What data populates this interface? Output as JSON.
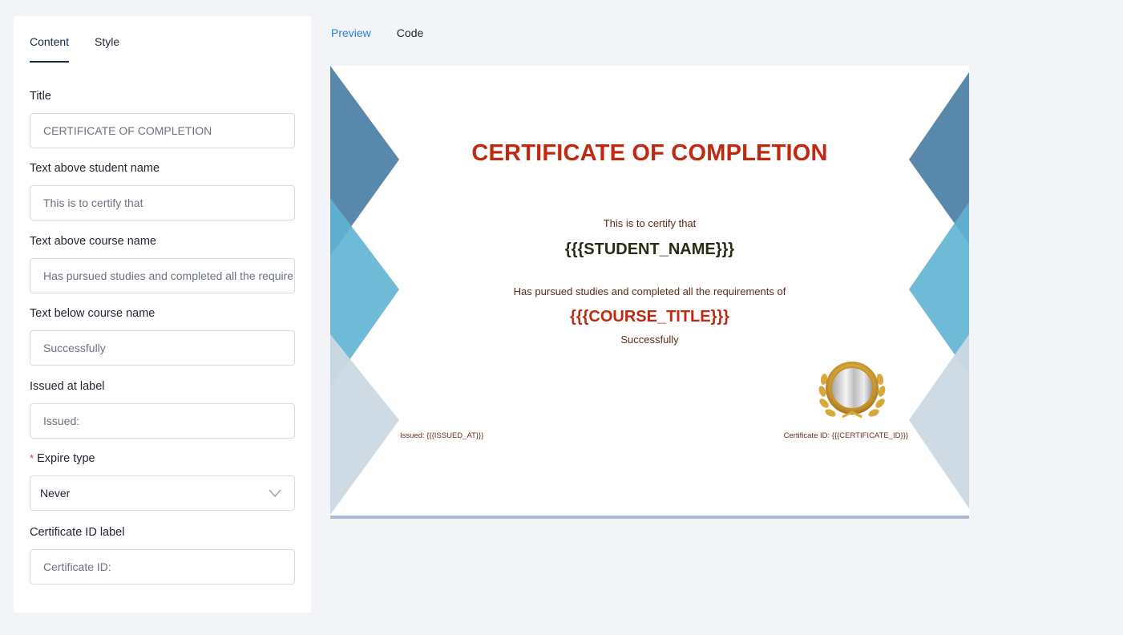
{
  "left_tabs": {
    "content": "Content",
    "style": "Style"
  },
  "fields": {
    "title": {
      "label": "Title",
      "value": "CERTIFICATE OF COMPLETION"
    },
    "above_student": {
      "label": "Text above student name",
      "value": "This is to certify that"
    },
    "above_course": {
      "label": "Text above course name",
      "value": "Has pursued studies and completed all the requirements of"
    },
    "below_course": {
      "label": "Text below course name",
      "value": "Successfully"
    },
    "issued_label": {
      "label": "Issued at label",
      "value": "Issued:"
    },
    "expire_type": {
      "required_mark": "*",
      "label": "Expire type",
      "value": "Never"
    },
    "cert_id_label": {
      "label": "Certificate ID label",
      "value": "Certificate ID:"
    }
  },
  "preview_tabs": {
    "preview": "Preview",
    "code": "Code"
  },
  "certificate": {
    "title": "CERTIFICATE OF COMPLETION",
    "above_student": "This is to certify that",
    "student_name": "{{{STUDENT_NAME}}}",
    "above_course": "Has pursued studies and completed all the requirements of",
    "course_title": "{{{COURSE_TITLE}}}",
    "below_course": "Successfully",
    "issued": "Issued: {{{ISSUED_AT}}}",
    "certificate_id": "Certificate ID: {{{CERTIFICATE_ID}}}"
  },
  "colors": {
    "accent_blue": "#2b7fd6",
    "active_tab": "#13294b",
    "cert_title_red": "#c0280f",
    "deco_dark": "#4f82a8",
    "deco_mid": "#5fb3d3",
    "deco_light": "#cbd9e3"
  }
}
